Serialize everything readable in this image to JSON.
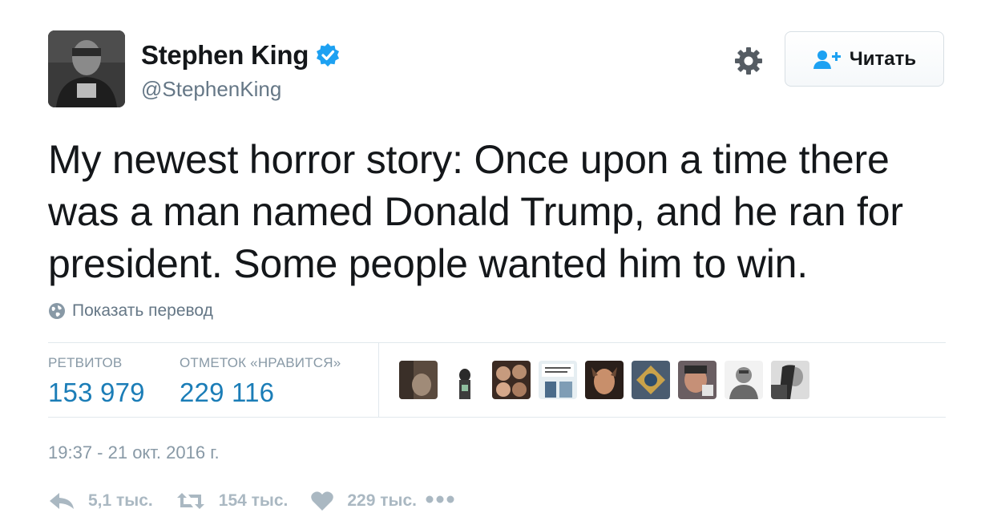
{
  "author": {
    "name": "Stephen King",
    "handle": "@StephenKing",
    "verified": true
  },
  "follow_button": {
    "label": "Читать",
    "icon": "add-user-icon"
  },
  "settings_icon": "gear-icon",
  "tweet": {
    "text": "My newest horror story: Once upon a time there was a man named Donald Trump, and he ran for president. Some people wanted him to win.",
    "translate_label": "Показать перевод"
  },
  "stats": {
    "retweets_label": "РЕТВИТОВ",
    "retweets_value": "153 979",
    "likes_label": "ОТМЕТОК «НРАВИТСЯ»",
    "likes_value": "229 116"
  },
  "likers_count": 9,
  "timestamp": "19:37 - 21 окт. 2016 г.",
  "actions": {
    "reply_count": "5,1 тыс.",
    "retweet_count": "154 тыс.",
    "like_count": "229 тыс."
  },
  "colors": {
    "link_blue": "#1b7db7",
    "verified_blue": "#1da1f2",
    "muted": "#8899a6",
    "action_gray": "#aab8c2"
  }
}
